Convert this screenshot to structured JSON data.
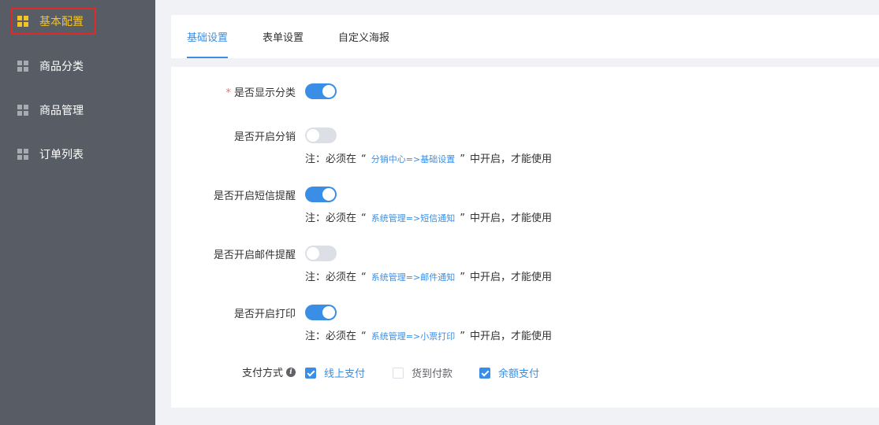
{
  "sidebar": {
    "items": [
      {
        "label": "基本配置",
        "icon": "grid-icon",
        "active": true
      },
      {
        "label": "商品分类",
        "icon": "grid-icon",
        "active": false
      },
      {
        "label": "商品管理",
        "icon": "grid-icon",
        "active": false
      },
      {
        "label": "订单列表",
        "icon": "grid-icon",
        "active": false
      }
    ]
  },
  "tabs": [
    {
      "label": "基础设置",
      "active": true
    },
    {
      "label": "表单设置",
      "active": false
    },
    {
      "label": "自定义海报",
      "active": false
    }
  ],
  "form": {
    "required_mark": "*",
    "rows": [
      {
        "label": "是否显示分类",
        "on": true
      },
      {
        "label": "是否开启分销",
        "on": false,
        "note_prefix": "注：必须在",
        "link": "分销中心=>基础设置",
        "note_suffix": "中开启，才能使用"
      },
      {
        "label": "是否开启短信提醒",
        "on": true,
        "note_prefix": "注：必须在",
        "link": "系统管理=>短信通知",
        "note_suffix": "中开启，才能使用"
      },
      {
        "label": "是否开启邮件提醒",
        "on": false,
        "note_prefix": "注：必须在",
        "link": "系统管理=>邮件通知",
        "note_suffix": "中开启，才能使用"
      },
      {
        "label": "是否开启打印",
        "on": true,
        "note_prefix": "注：必须在",
        "link": "系统管理=>小票打印",
        "note_suffix": "中开启，才能使用"
      }
    ],
    "quote_open": "“",
    "quote_close": "”",
    "payment": {
      "label": "支付方式",
      "info_icon": "info-icon",
      "options": [
        {
          "label": "线上支付",
          "checked": true
        },
        {
          "label": "货到付款",
          "checked": false
        },
        {
          "label": "余额支付",
          "checked": true
        }
      ]
    }
  },
  "colors": {
    "sidebar_bg": "#585c64",
    "active_yellow": "#f5c324",
    "primary_blue": "#3a8ee6",
    "highlight_red": "#e02a2a"
  }
}
